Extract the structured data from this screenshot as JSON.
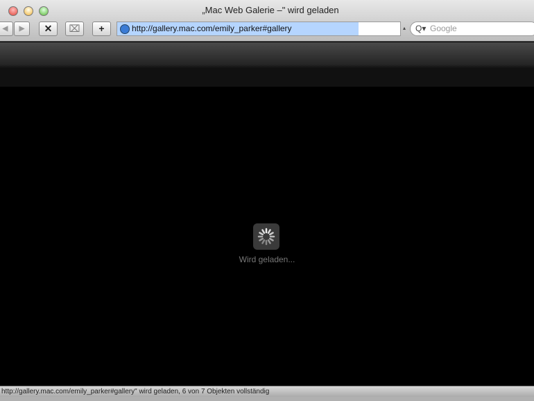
{
  "window": {
    "title": "„Mac Web Galerie –\" wird geladen"
  },
  "toolbar": {
    "back": "◀",
    "forward": "▶",
    "stop": "✕",
    "snapback": "⌧",
    "add": "+",
    "url": "http://gallery.mac.com/emily_parker#gallery",
    "search_placeholder": "Google",
    "search_icon": "Q▾"
  },
  "content": {
    "loading_text": "Wird geladen..."
  },
  "status": {
    "text": "http://gallery.mac.com/emily_parker#gallery\" wird geladen, 6 von 7 Objekten vollständig"
  },
  "colors": {
    "close": "#e0473a",
    "minimize": "#f0b23a",
    "zoom": "#5cb83a"
  }
}
